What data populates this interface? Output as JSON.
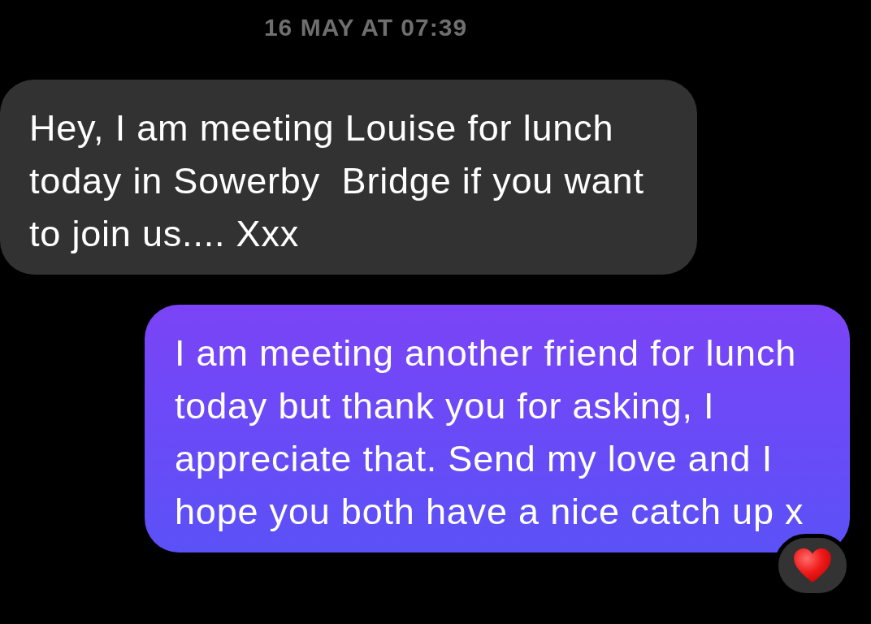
{
  "timestamp": "16 MAY AT 07:39",
  "messages": [
    {
      "kind": "received",
      "text": "Hey, I am meeting Louise for lunch today in Sowerby  Bridge if you want to join us.... Xxx"
    },
    {
      "kind": "sent",
      "text": "I am meeting another friend for lunch today but thank you for asking, I appreciate that. Send my love and I hope you both have a nice catch up x",
      "reactions": [
        {
          "kind": "heart"
        }
      ]
    }
  ]
}
